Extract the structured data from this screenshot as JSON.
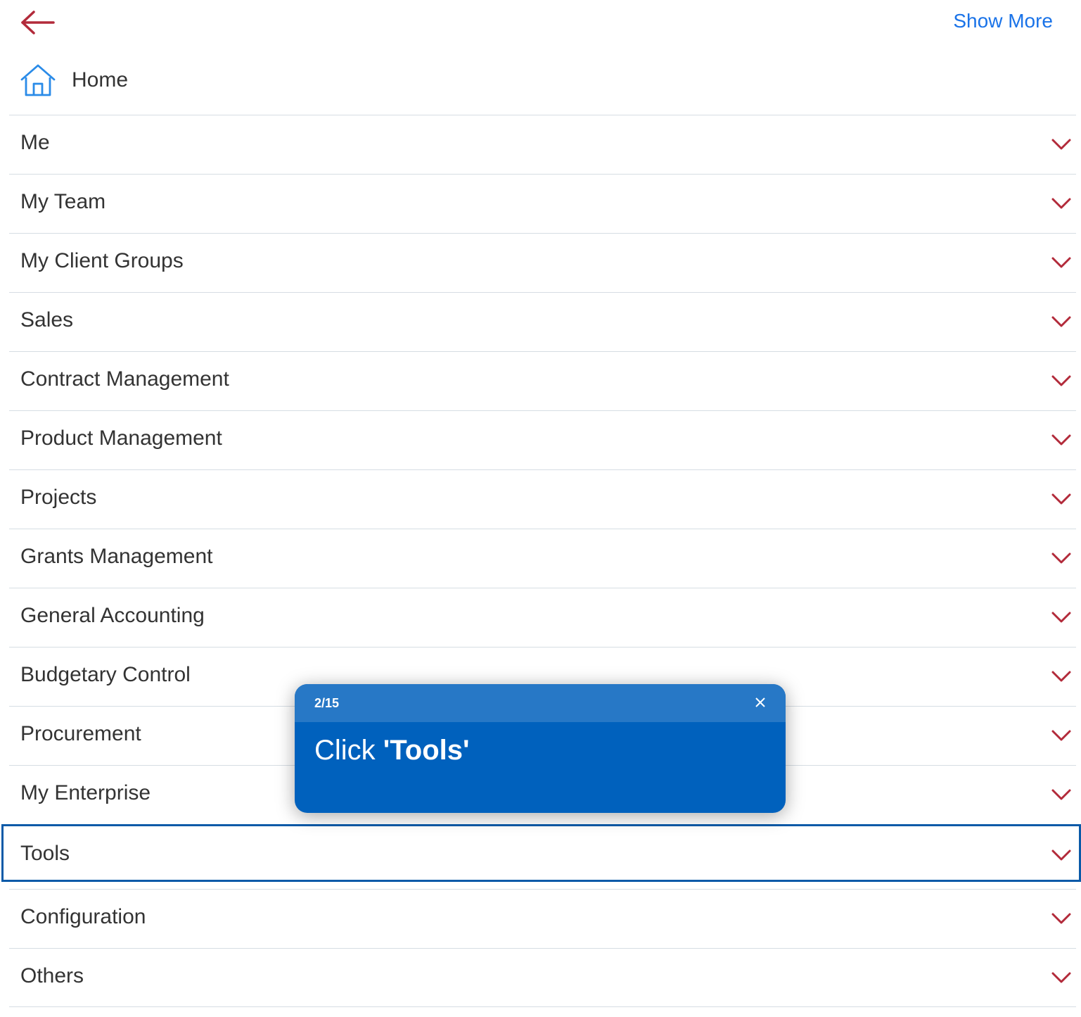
{
  "header": {
    "show_more_label": "Show More",
    "back_icon": "arrow-left-icon"
  },
  "home": {
    "label": "Home",
    "icon": "home-icon"
  },
  "menu": {
    "items": [
      {
        "label": "Me"
      },
      {
        "label": "My Team"
      },
      {
        "label": "My Client Groups"
      },
      {
        "label": "Sales"
      },
      {
        "label": "Contract Management"
      },
      {
        "label": "Product Management"
      },
      {
        "label": "Projects"
      },
      {
        "label": "Grants Management"
      },
      {
        "label": "General Accounting"
      },
      {
        "label": "Budgetary Control"
      },
      {
        "label": "Procurement"
      },
      {
        "label": "My Enterprise"
      },
      {
        "label": "Tools"
      },
      {
        "label": "Configuration"
      },
      {
        "label": "Others"
      }
    ],
    "highlighted_index": 12
  },
  "tooltip": {
    "step": "2/15",
    "prefix": "Click ",
    "target": "'Tools'"
  },
  "colors": {
    "accent_red": "#b22a3a",
    "link_blue": "#1a73e8",
    "tooltip_bg": "#0061bd",
    "tooltip_header": "#2778c6",
    "highlight_border": "#0a5aa8"
  }
}
